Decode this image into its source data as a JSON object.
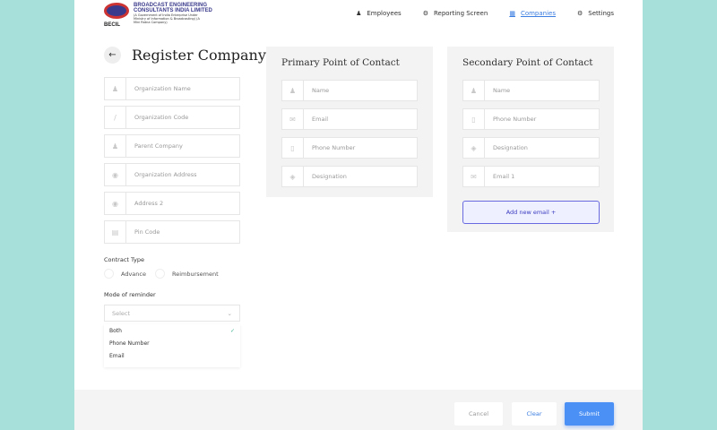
{
  "logo": {
    "abbr": "BECIL",
    "name_line1": "BROADCAST ENGINEERING",
    "name_line2": "CONSULTANTS INDIA LIMITED",
    "tagline": "(A Government of India Enterprise Under Ministry of Information & Broadcasting) (A Mini Ratna Company)"
  },
  "nav": [
    {
      "label": "Employees",
      "icon": "person-icon"
    },
    {
      "label": "Reporting Screen",
      "icon": "report-icon"
    },
    {
      "label": "Companies",
      "icon": "building-icon",
      "active": true
    },
    {
      "label": "Settings",
      "icon": "gear-icon"
    }
  ],
  "page_title": "Register Company",
  "org_fields": [
    {
      "placeholder": "Organization Name",
      "icon": "person-add-icon"
    },
    {
      "placeholder": "Organization Code",
      "icon": "code-icon"
    },
    {
      "placeholder": "Parent Company",
      "icon": "person-add-icon"
    },
    {
      "placeholder": "Organization Address",
      "icon": "location-icon"
    },
    {
      "placeholder": "Address 2",
      "icon": "location-icon"
    },
    {
      "placeholder": "Pin Code",
      "icon": "trash-icon"
    }
  ],
  "contract_type": {
    "label": "Contract Type",
    "options": [
      "Advance",
      "Reimbursement"
    ]
  },
  "reminder": {
    "label": "Mode of reminder",
    "placeholder": "Select",
    "options": [
      "Both",
      "Phone Number",
      "Email"
    ],
    "checked": "Both"
  },
  "primary": {
    "title": "Primary Point of Contact",
    "fields": [
      {
        "placeholder": "Name",
        "icon": "person-icon"
      },
      {
        "placeholder": "Email",
        "icon": "mail-icon"
      },
      {
        "placeholder": "Phone Number",
        "icon": "phone-icon"
      },
      {
        "placeholder": "Designation",
        "icon": "tag-icon"
      }
    ]
  },
  "secondary": {
    "title": "Secondary Point of Contact",
    "fields": [
      {
        "placeholder": "Name",
        "icon": "person-icon"
      },
      {
        "placeholder": "Phone Number",
        "icon": "phone-icon"
      },
      {
        "placeholder": "Designation",
        "icon": "tag-icon"
      },
      {
        "placeholder": "Email 1",
        "icon": "mail-icon"
      }
    ],
    "add_email": "Add new email +"
  },
  "footer": {
    "cancel": "Cancel",
    "clear": "Clear",
    "submit": "Submit"
  },
  "colors": {
    "accent": "#3b7de0",
    "background": "#a7dfdb"
  }
}
